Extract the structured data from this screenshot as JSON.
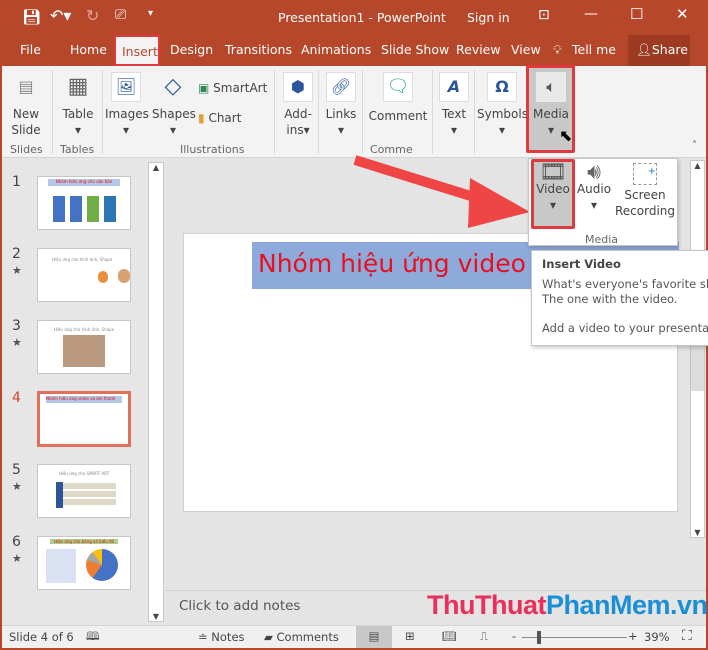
{
  "window": {
    "title": "Presentation1  -  PowerPoint",
    "sign_in": "Sign in"
  },
  "tabs": [
    "File",
    "Home",
    "Insert",
    "Design",
    "Transitions",
    "Animations",
    "Slide Show",
    "Review",
    "View",
    "Tell me",
    "Share"
  ],
  "active_tab": "Insert",
  "ribbon": {
    "new_slide": "New",
    "new_slide2": "Slide",
    "table": "Table",
    "images": "Images",
    "shapes": "Shapes",
    "smartart": "SmartArt",
    "chart": "Chart",
    "addins": "Add-",
    "addins2": "ins",
    "links": "Links",
    "comment": "Comment",
    "text": "Text",
    "symbols": "Symbols",
    "media": "Media",
    "groups": {
      "slides": "Slides",
      "tables": "Tables",
      "illustrations": "Illustrations",
      "comments": "Comme"
    }
  },
  "media_menu": {
    "video": "Video",
    "audio": "Audio",
    "screen": "Screen",
    "recording": "Recording",
    "group": "Media"
  },
  "tooltip": {
    "title": "Insert Video",
    "line1": "What's everyone's favorite slide",
    "line2": "The one with the video.",
    "line3": "Add a video to your presentation"
  },
  "slides": [
    {
      "num": "1",
      "title": "Nhóm hiệu ứng cho văn bản"
    },
    {
      "num": "2",
      "title": "Hiệu ứng cho hình ảnh, Shape"
    },
    {
      "num": "3",
      "title": "Hiệu ứng cho hình ảnh, Shape"
    },
    {
      "num": "4",
      "title": "Nhóm hiệu ứng video và âm thanh"
    },
    {
      "num": "5",
      "title": "Hiệu ứng cho SMART ART"
    },
    {
      "num": "6",
      "title": "Hiệu ứng cho bảng và biểu đồ"
    }
  ],
  "slide_title": "Nhóm hiệu ứng video và â",
  "notes_placeholder": "Click to add notes",
  "watermark": "ThuThuatPhanMem.vn",
  "status": {
    "slide": "Slide 4 of 6",
    "notes": "Notes",
    "comments": "Comments",
    "zoom": "39%",
    "zoom_level": 39
  },
  "colors": {
    "accent": "#b7472a",
    "highlight": "#e0393e",
    "title_red": "#e8101e",
    "title_bg": "#8eaadb"
  }
}
